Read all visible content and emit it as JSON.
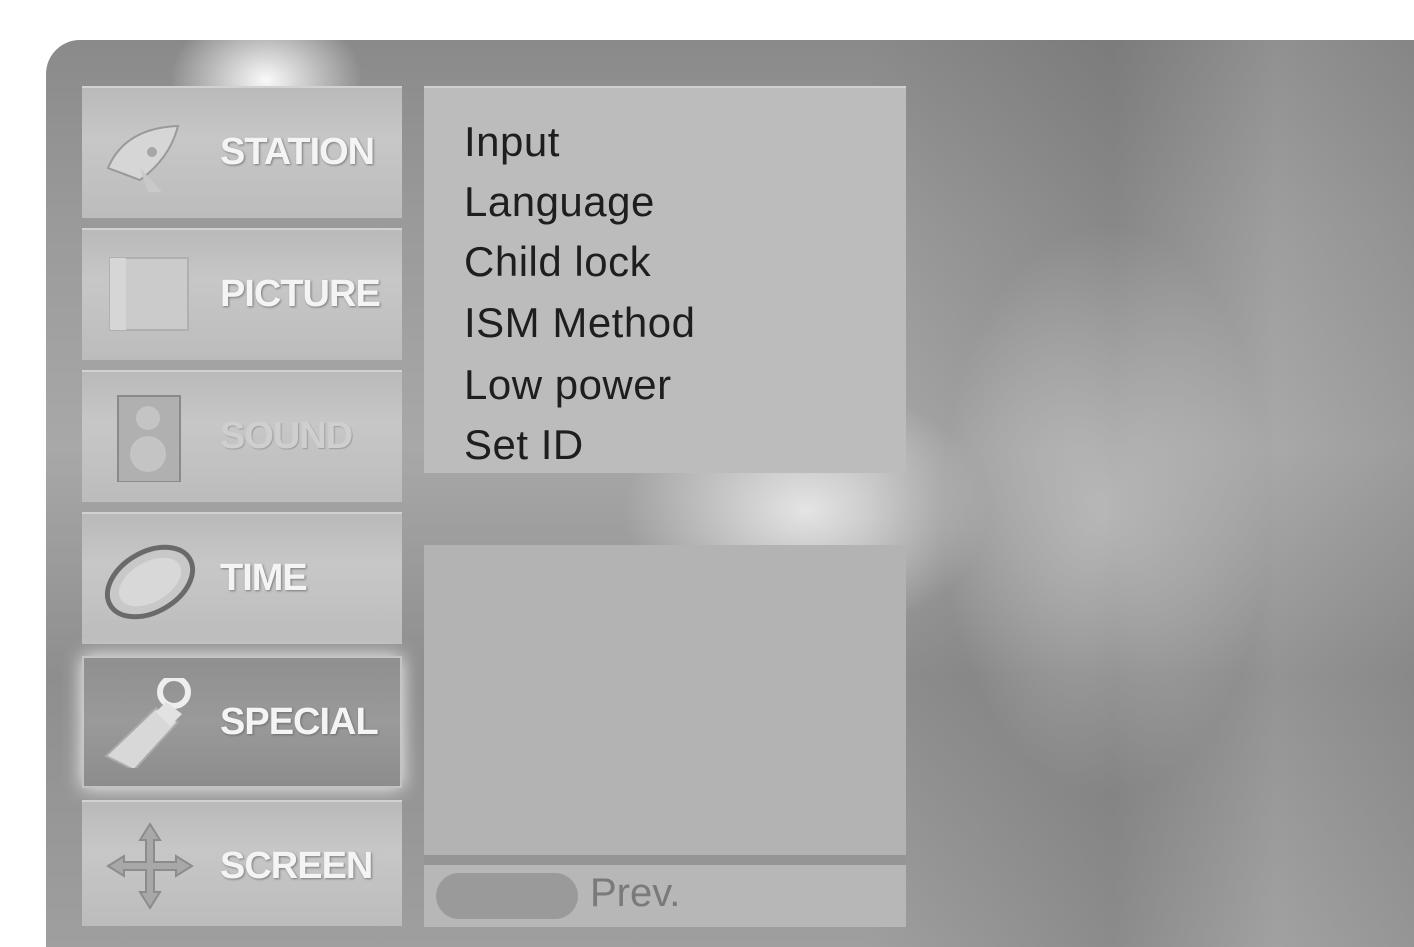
{
  "menu": {
    "tabs": [
      {
        "label": "STATION",
        "icon": "satellite-dish-icon",
        "active": false
      },
      {
        "label": "PICTURE",
        "icon": "picture-icon",
        "active": false
      },
      {
        "label": "SOUND",
        "icon": "speaker-icon",
        "active": false
      },
      {
        "label": "TIME",
        "icon": "clock-icon",
        "active": false
      },
      {
        "label": "SPECIAL",
        "icon": "tag-icon",
        "active": true
      },
      {
        "label": "SCREEN",
        "icon": "move-arrows-icon",
        "active": false
      }
    ],
    "submenu_items": [
      "Input",
      "Language",
      "Child lock",
      "ISM Method",
      "Low power",
      "Set ID"
    ],
    "footer": {
      "prev_label": "Prev."
    }
  }
}
